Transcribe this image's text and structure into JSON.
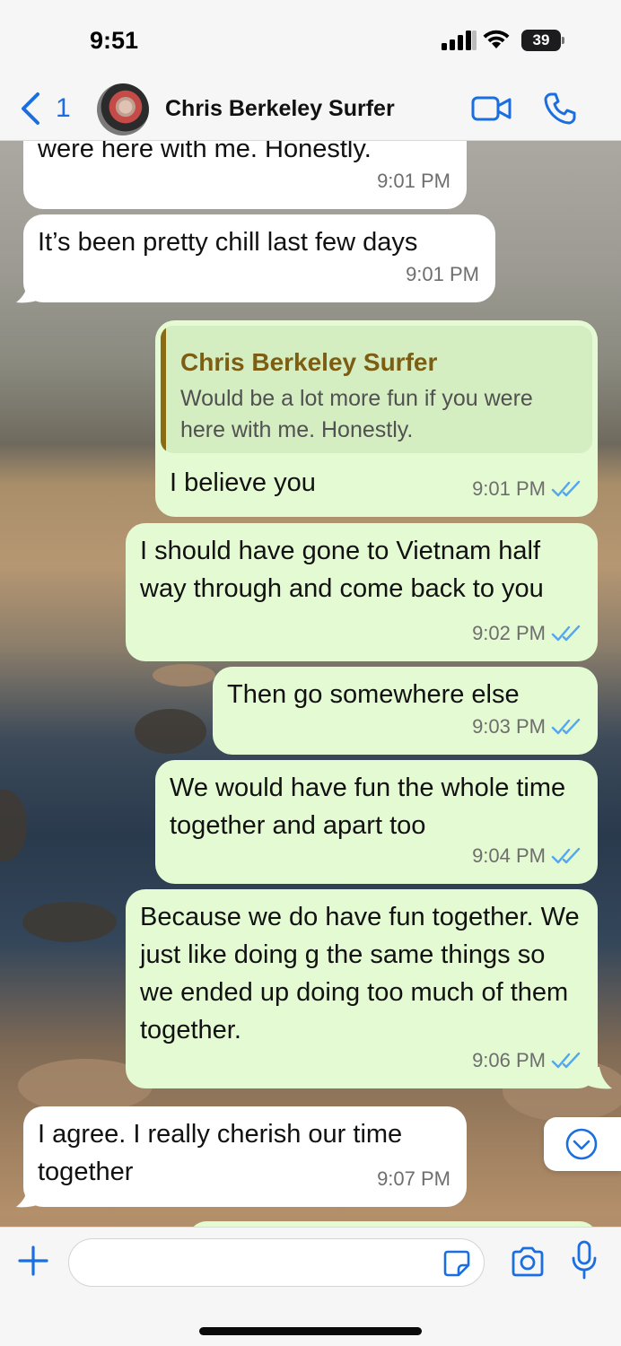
{
  "status_bar": {
    "time": "9:51",
    "battery": "39"
  },
  "header": {
    "back_count": "1",
    "contact_name": "Chris Berkeley Surfer"
  },
  "messages": [
    {
      "direction": "in",
      "text": "were here with me. Honestly.",
      "time": "9:01 PM"
    },
    {
      "direction": "in",
      "text": "It’s been pretty chill last few days",
      "time": "9:01 PM"
    },
    {
      "direction": "out",
      "quote_name": "Chris Berkeley Surfer",
      "quote_text": "Would be a lot more fun if you were here with me. Honestly.",
      "text": "I believe you",
      "time": "9:01 PM"
    },
    {
      "direction": "out",
      "text": "I should have gone to Vietnam half way through and come back to you",
      "time": "9:02 PM"
    },
    {
      "direction": "out",
      "text": "Then go somewhere else",
      "time": "9:03 PM"
    },
    {
      "direction": "out",
      "text": "We would have fun the whole time together and apart too",
      "time": "9:04 PM"
    },
    {
      "direction": "out",
      "text": "Because we do have fun together. We just like doing g the same things so we ended up doing too much of them together.",
      "time": "9:06 PM"
    },
    {
      "direction": "in",
      "text": "I agree. I really cherish our time together",
      "time": "9:07 PM"
    }
  ],
  "composer": {
    "placeholder": "",
    "value": ""
  },
  "colors": {
    "accent": "#1a6fe0",
    "outgoing_bubble": "#e3fad2",
    "incoming_bubble": "#ffffff",
    "read_ticks": "#53a6f2"
  },
  "icons": [
    "back-chevron-icon",
    "video-call-icon",
    "phone-icon",
    "plus-icon",
    "sticker-icon",
    "camera-icon",
    "microphone-icon",
    "scroll-down-icon",
    "read-ticks-icon"
  ]
}
